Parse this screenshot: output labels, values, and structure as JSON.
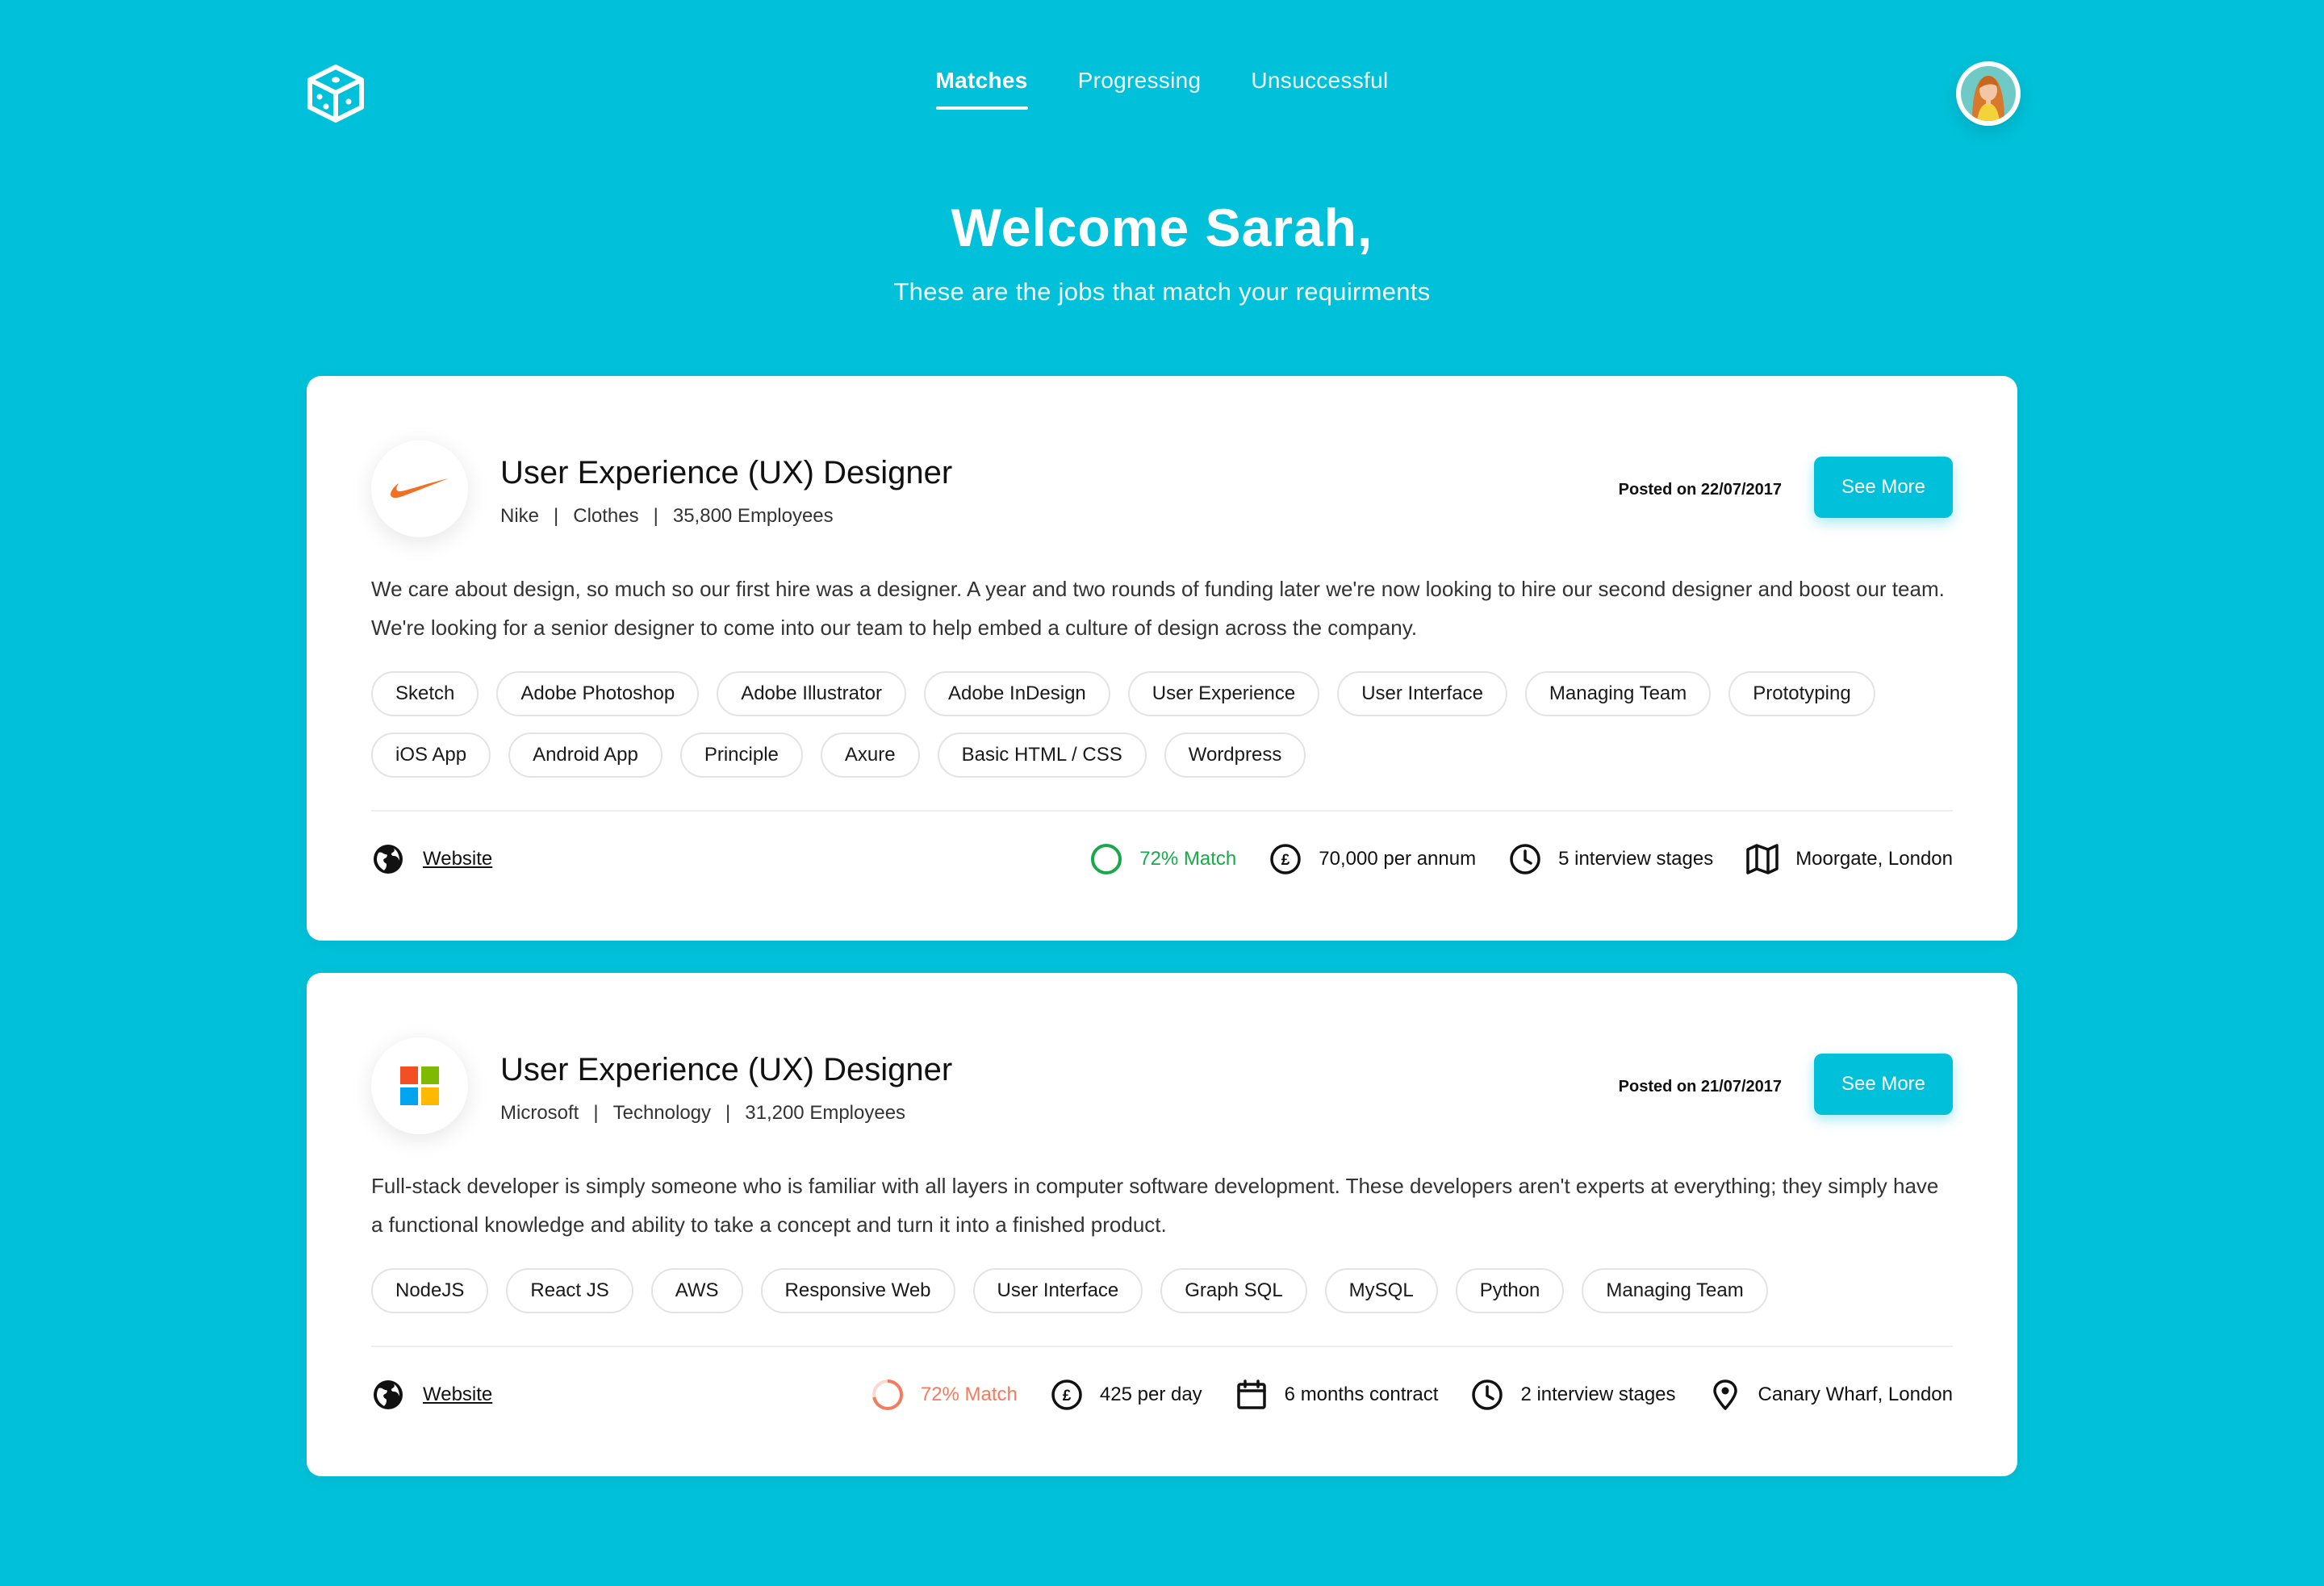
{
  "nav": {
    "tabs": [
      {
        "label": "Matches"
      },
      {
        "label": "Progressing"
      },
      {
        "label": "Unsuccessful"
      }
    ],
    "active": 0
  },
  "hero": {
    "title": "Welcome Sarah,",
    "subtitle": "These are the jobs that match your requirments"
  },
  "colors": {
    "accent": "#00c1d9",
    "match_good": "#19a84a",
    "match_partial": "#f47c5e"
  },
  "jobs": [
    {
      "title": "User Experience (UX) Designer",
      "company": "Nike",
      "industry": "Clothes",
      "employees": "35,800 Employees",
      "posted": "Posted on 22/07/2017",
      "button": "See More",
      "description": "We care about design, so much so our first hire was a designer. A year and two rounds of funding later we're now looking to hire our second designer and boost our team. We're looking for a senior designer to come into our team to help embed a culture of design across the company.",
      "tags": [
        "Sketch",
        "Adobe Photoshop",
        "Adobe Illustrator",
        "Adobe InDesign",
        "User Experience",
        "User Interface",
        "Managing Team",
        "Prototyping",
        "iOS App",
        "Android App",
        "Principle",
        "Axure",
        "Basic HTML / CSS",
        "Wordpress"
      ],
      "website": "Website",
      "match": "72% Match",
      "salary": "70,000 per annum",
      "interview": "5 interview stages",
      "location": "Moorgate, London"
    },
    {
      "title": "User Experience (UX) Designer",
      "company": "Microsoft",
      "industry": "Technology",
      "employees": "31,200 Employees",
      "posted": "Posted on 21/07/2017",
      "button": "See More",
      "description": "Full-stack developer is simply someone who is familiar with all layers in computer software development. These developers aren't experts at everything; they simply have a functional knowledge and ability to take a concept and turn it into a finished product.",
      "tags": [
        "NodeJS",
        "React JS",
        "AWS",
        "Responsive Web",
        "User Interface",
        "Graph SQL",
        "MySQL",
        "Python",
        "Managing Team"
      ],
      "website": "Website",
      "match": "72% Match",
      "salary": "425 per day",
      "contract": "6 months contract",
      "interview": "2 interview stages",
      "location": "Canary Wharf, London"
    }
  ]
}
